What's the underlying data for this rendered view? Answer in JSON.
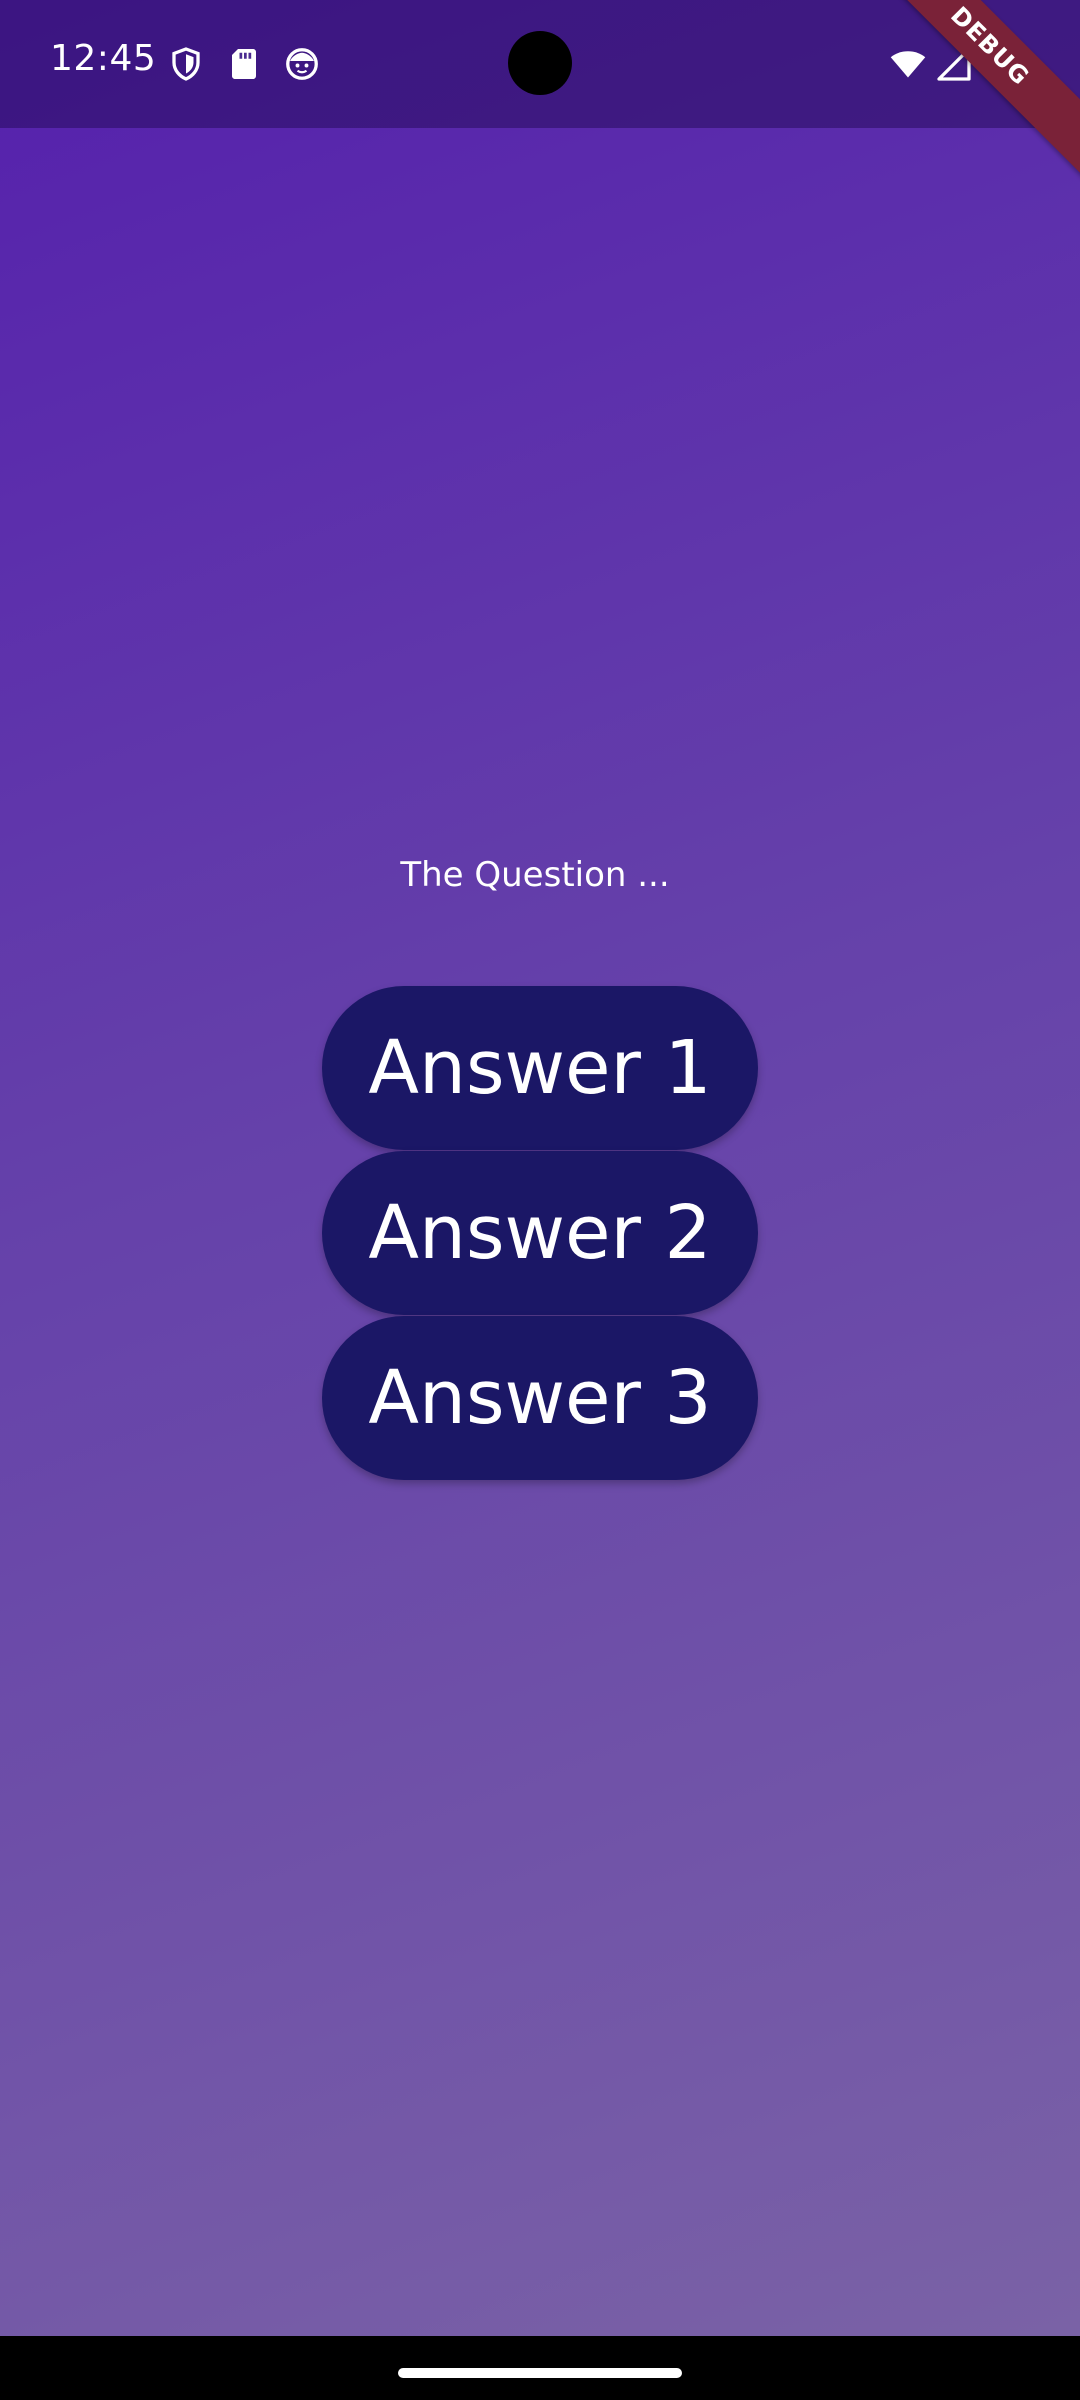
{
  "status_bar": {
    "time": "12:45",
    "left_icons": [
      "shield-icon",
      "sd-card-icon",
      "face-icon"
    ],
    "right_icons": [
      "wifi-icon",
      "signal-icon"
    ]
  },
  "debug_banner": {
    "label": "DEBUG"
  },
  "quiz": {
    "question": "The Question ...",
    "answers": [
      "Answer 1",
      "Answer 2",
      "Answer 3"
    ]
  },
  "colors": {
    "background_top": "#5520ad",
    "background_bottom": "#7a62a6",
    "button": "#1b1766",
    "debug_banner": "#7a2238"
  }
}
